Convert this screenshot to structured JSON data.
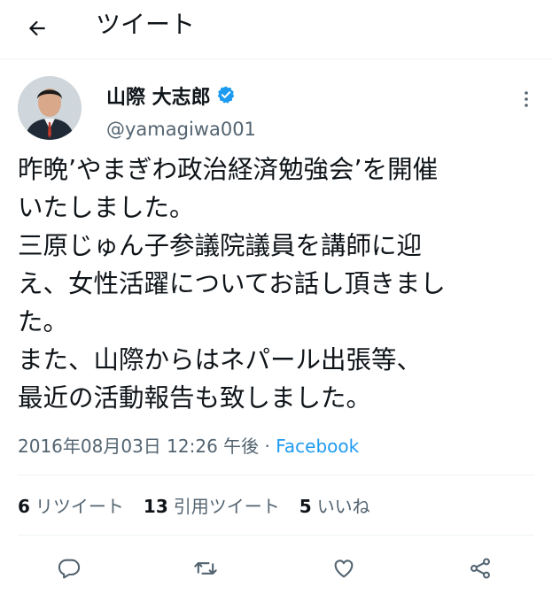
{
  "header": {
    "title": "ツイート"
  },
  "author": {
    "name": "山際 大志郎",
    "handle": "@yamagiwa001"
  },
  "tweet": {
    "lines": [
      "昨晩’やまぎわ政治経済勉強会’を開催",
      "いたしました。",
      "三原じゅん子参議院議員を講師に迎",
      "え、女性活躍についてお話し頂きまし",
      "た。",
      "また、山際からはネパール出張等、",
      "最近の活動報告も致しました。"
    ]
  },
  "meta": {
    "timestamp": "2016年08月03日 12:26 午後",
    "separator": " · ",
    "source": "Facebook"
  },
  "stats": {
    "retweets_count": "6",
    "retweets_label": "リツイート",
    "quotes_count": "13",
    "quotes_label": "引用ツイート",
    "likes_count": "5",
    "likes_label": "いいね"
  },
  "colors": {
    "accent": "#1d9bf0",
    "secondary": "#536471",
    "text": "#0f1419"
  },
  "icons": [
    "back-arrow-icon",
    "verified-badge-icon",
    "more-options-icon",
    "reply-icon",
    "retweet-icon",
    "like-icon",
    "share-icon"
  ]
}
